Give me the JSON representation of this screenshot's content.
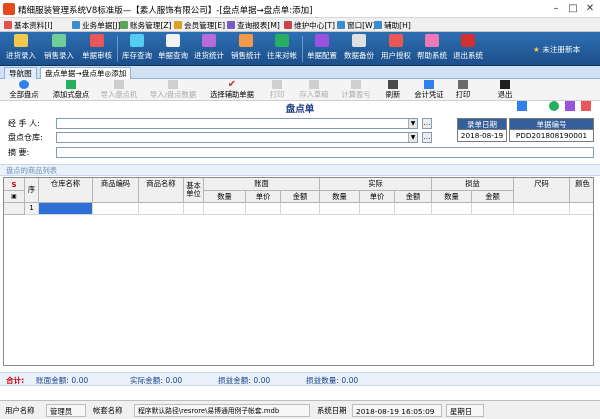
{
  "window": {
    "title": "精细服装管理系统V8标准版—【素人服饰有限公司】-[盘点单据→盘点单:添加]"
  },
  "menu": [
    "基本资料[I]",
    "业务单据[J]",
    "账务管理[Z]",
    "会员管理[E]",
    "查询报表[M]",
    "维护中心[T]",
    "窗口[W]",
    "辅助[H]"
  ],
  "toolbar": {
    "group1": [
      "进货录入",
      "销售录入",
      "单据审核"
    ],
    "group2": [
      "库存查询",
      "单据查询",
      "进货统计",
      "销售统计",
      "往来对帐"
    ],
    "group3": [
      "单据配置",
      "数据备份",
      "用户授权",
      "帮助系统",
      "退出系统"
    ],
    "unregistered": "未注册新本"
  },
  "tabs": {
    "nav": "导航图",
    "doc": "盘点单据→盘点单◎添加"
  },
  "actions": [
    {
      "label": "全部盘点",
      "enabled": true
    },
    {
      "label": "添加式盘点",
      "enabled": true
    },
    {
      "label": "导入盘点机",
      "enabled": false
    },
    {
      "label": "导入/盘点数据",
      "enabled": false
    },
    {
      "label": "选择辅助单据",
      "enabled": true
    },
    {
      "label": "打印",
      "enabled": false
    },
    {
      "label": "存入草稿",
      "enabled": false
    },
    {
      "label": "计算盈亏",
      "enabled": false
    },
    {
      "label": "刷新",
      "enabled": true
    },
    {
      "label": "会计凭证",
      "enabled": true
    },
    {
      "label": "打印",
      "enabled": true
    },
    {
      "label": "退出",
      "enabled": true
    }
  ],
  "form": {
    "title": "盘点单",
    "handler_label": "经 手 人:",
    "warehouse_label": "盘点仓库:",
    "memo_label": "摘    要:",
    "date_header": "录单日期",
    "date_value": "2018-08-19",
    "docno_header": "单据编号",
    "docno_value": "PDD201808190001"
  },
  "grid": {
    "caption": "盘点的商品列表",
    "top_headers": [
      "账面",
      "实际",
      "损益"
    ],
    "headers": [
      "序",
      "仓库名称",
      "商品编码",
      "商品名称",
      "基本单位",
      "数量",
      "单价",
      "金额",
      "数量",
      "单价",
      "金额",
      "数量",
      "金额",
      "尺码",
      "颜色"
    ],
    "corner": "S",
    "row1": "1"
  },
  "totals": {
    "label": "合计:",
    "book_amount": "账面金额: 0.00",
    "actual_amount": "实际金额: 0.00",
    "pl_amount": "损益金额: 0.00",
    "pl_qty": "损益数量: 0.00"
  },
  "status": {
    "user_label": "用户名称",
    "user_value": "管理员",
    "set_label": "帐套名称",
    "set_value": "程序默认路径\\resrore\\易博通用例子帐套.mdb",
    "date_label": "系统日期",
    "date_value": "2018-08-19  16:05:09",
    "weekday": "星期日"
  },
  "colors": {
    "toolbar": "#1d4f8a",
    "accent": "#355f9a",
    "total_label": "#c00000"
  }
}
